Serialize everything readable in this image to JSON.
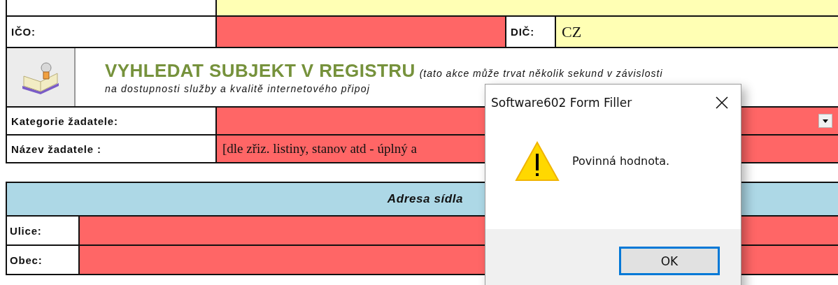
{
  "ico": {
    "label": "IČO:",
    "invalid": true
  },
  "dic": {
    "label": "DIČ:",
    "value": "CZ",
    "invalid": false
  },
  "registry_search": {
    "title": "VYHLEDAT SUBJEKT V REGISTRU",
    "note_line_1": "(tato akce může trvat několik sekund v závislosti",
    "note_line_2": "na dostupnosti služby a kvalitě internetového připoj"
  },
  "applicant_fields": [
    {
      "kind": "dropdown",
      "label": "Kategorie žadatele:",
      "invalid": true
    },
    {
      "kind": "text",
      "label": "Název žadatele :",
      "value": "[dle zřiz. listiny, stanov atd - úplný a",
      "invalid": true
    }
  ],
  "address": {
    "heading": "Adresa sídla",
    "fields": [
      {
        "label": "Ulice:",
        "invalid": true
      },
      {
        "label": "Obec:",
        "invalid": true
      }
    ]
  },
  "dialog": {
    "title": "Software602 Form Filler",
    "message": "Povinná hodnota.",
    "buttons": [
      {
        "label": "OK",
        "focused": true
      }
    ]
  }
}
